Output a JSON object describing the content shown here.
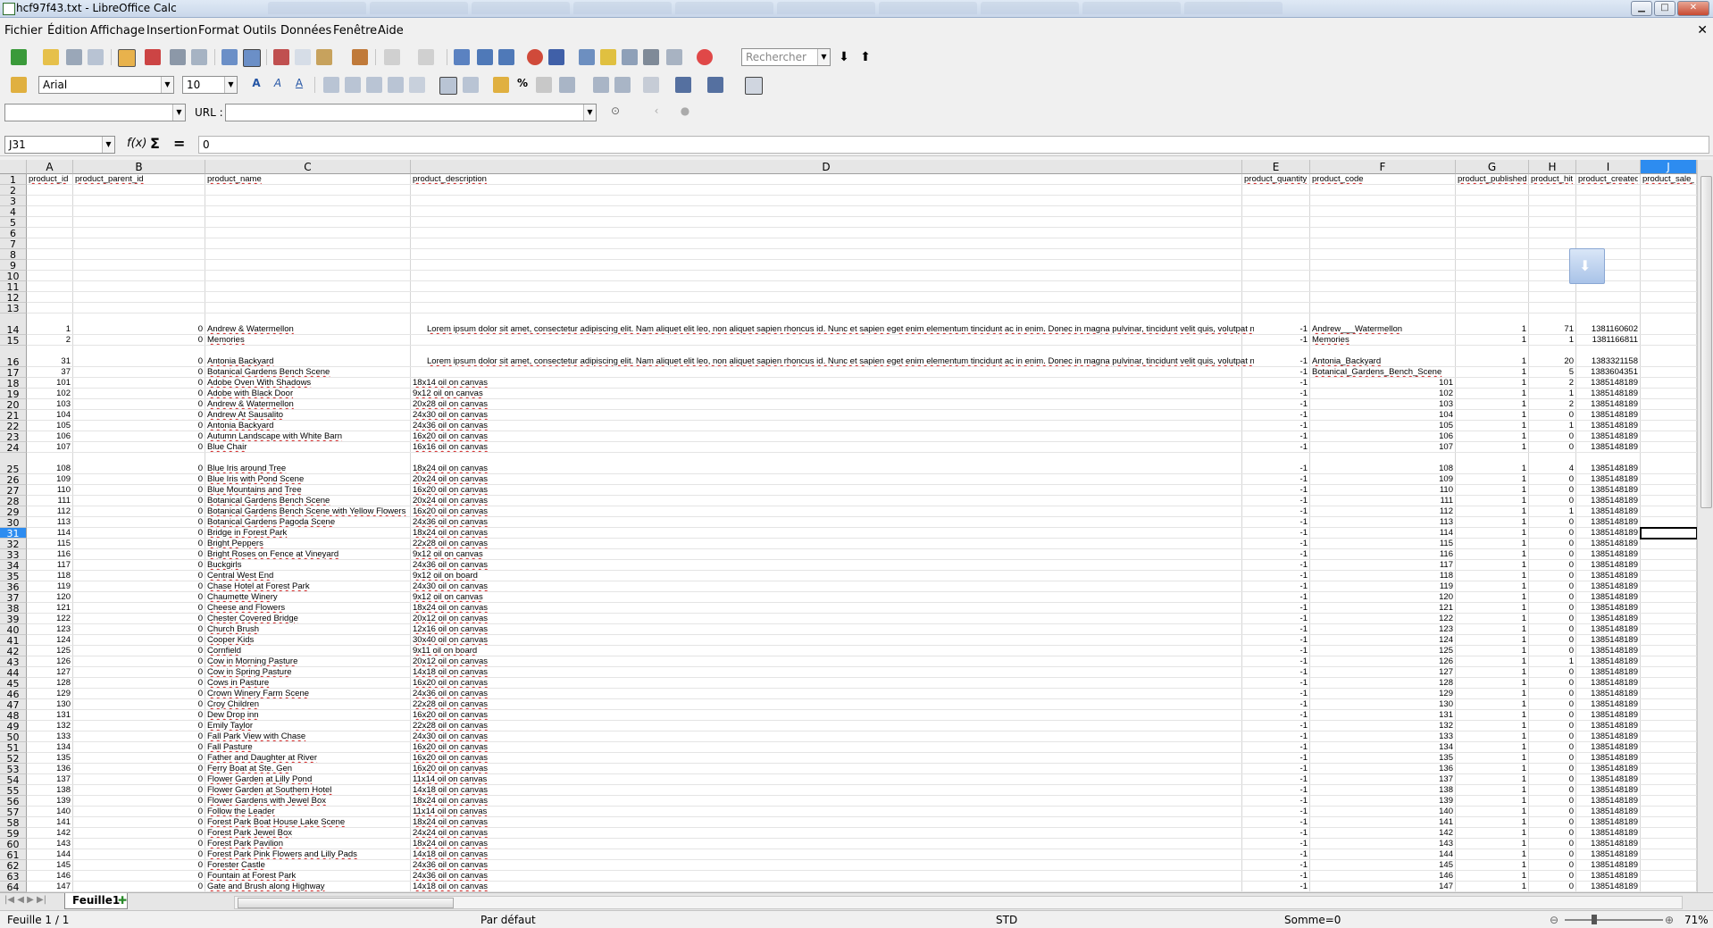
{
  "window": {
    "title": "hcf97f43.txt - LibreOffice Calc"
  },
  "menu": [
    "Fichier",
    "Édition",
    "Affichage",
    "Insertion",
    "Format",
    "Outils",
    "Données",
    "Fenêtre",
    "Aide"
  ],
  "toolbar": {
    "search_placeholder": "Rechercher",
    "font_name": "Arial",
    "font_size": "10"
  },
  "hyperlink_bar": {
    "url_label": "URL :",
    "url_value": ""
  },
  "formula_bar": {
    "name_box": "J31",
    "formula": "0"
  },
  "columns": [
    {
      "letter": "A",
      "header": "product_id"
    },
    {
      "letter": "B",
      "header": "product_parent_id"
    },
    {
      "letter": "C",
      "header": "product_name"
    },
    {
      "letter": "D",
      "header": "product_description"
    },
    {
      "letter": "E",
      "header": "product_quantity"
    },
    {
      "letter": "F",
      "header": "product_code"
    },
    {
      "letter": "G",
      "header": "product_published"
    },
    {
      "letter": "H",
      "header": "product_hit"
    },
    {
      "letter": "I",
      "header": "product_created"
    },
    {
      "letter": "J",
      "header": "product_sale_s"
    }
  ],
  "lorem": "Lorem ipsum dolor sit amet, consectetur adipiscing elit. Nam aliquet elit leo, non aliquet sapien rhoncus id. Nunc et sapien eget enim elementum tincidunt ac in enim. Donec in magna pulvinar, tincidunt velit quis, volutpat nu",
  "rows": [
    {
      "n": 14,
      "a": "1",
      "b": "0",
      "c": "Andrew & Watermellon",
      "d": "lorem",
      "e": "-1",
      "f": "Andrew___Watermellon",
      "g": "1",
      "h": "71",
      "i": "1381160602"
    },
    {
      "n": 15,
      "a": "2",
      "b": "0",
      "c": "Memories",
      "d": "",
      "e": "-1",
      "f": "Memories",
      "g": "1",
      "h": "1",
      "i": "1381166811"
    },
    {
      "n": 16,
      "a": "31",
      "b": "0",
      "c": "Antonia Backyard",
      "d": "lorem",
      "e": "-1",
      "f": "Antonia_Backyard",
      "g": "1",
      "h": "20",
      "i": "1383321158"
    },
    {
      "n": 17,
      "a": "37",
      "b": "0",
      "c": "Botanical Gardens Bench Scene",
      "d": "",
      "e": "-1",
      "f": "Botanical_Gardens_Bench_Scene",
      "g": "1",
      "h": "5",
      "i": "1383604351"
    },
    {
      "n": 18,
      "a": "101",
      "b": "0",
      "c": "Adobe Oven With Shadows",
      "d": "18x14 oil on canvas",
      "e": "-1",
      "f": "101",
      "g": "1",
      "h": "2",
      "i": "1385148189"
    },
    {
      "n": 19,
      "a": "102",
      "b": "0",
      "c": "Adobe with Black Door",
      "d": "9x12 oil on canvas",
      "e": "-1",
      "f": "102",
      "g": "1",
      "h": "1",
      "i": "1385148189"
    },
    {
      "n": 20,
      "a": "103",
      "b": "0",
      "c": "Andrew & Watermellon",
      "d": "20x28 oil on canvas",
      "e": "-1",
      "f": "103",
      "g": "1",
      "h": "2",
      "i": "1385148189"
    },
    {
      "n": 21,
      "a": "104",
      "b": "0",
      "c": "Andrew At Sausalito",
      "d": "24x30 oil on canvas",
      "e": "-1",
      "f": "104",
      "g": "1",
      "h": "0",
      "i": "1385148189"
    },
    {
      "n": 22,
      "a": "105",
      "b": "0",
      "c": "Antonia Backyard",
      "d": "24x36 oil on canvas",
      "e": "-1",
      "f": "105",
      "g": "1",
      "h": "1",
      "i": "1385148189"
    },
    {
      "n": 23,
      "a": "106",
      "b": "0",
      "c": "Autumn Landscape with White Barn",
      "d": "16x20 oil on canvas",
      "e": "-1",
      "f": "106",
      "g": "1",
      "h": "0",
      "i": "1385148189"
    },
    {
      "n": 24,
      "a": "107",
      "b": "0",
      "c": "Blue Chair",
      "d": "16x16 oil on canvas",
      "e": "-1",
      "f": "107",
      "g": "1",
      "h": "0",
      "i": "1385148189"
    },
    {
      "n": 25,
      "a": "108",
      "b": "0",
      "c": "Blue Iris around Tree",
      "d": "18x24 oil on canvas",
      "e": "-1",
      "f": "108",
      "g": "1",
      "h": "4",
      "i": "1385148189"
    },
    {
      "n": 26,
      "a": "109",
      "b": "0",
      "c": "Blue Iris with Pond Scene",
      "d": "20x24 oil on canvas",
      "e": "-1",
      "f": "109",
      "g": "1",
      "h": "0",
      "i": "1385148189"
    },
    {
      "n": 27,
      "a": "110",
      "b": "0",
      "c": "Blue Mountains and Tree",
      "d": "16x20 oil on canvas",
      "e": "-1",
      "f": "110",
      "g": "1",
      "h": "0",
      "i": "1385148189"
    },
    {
      "n": 28,
      "a": "111",
      "b": "0",
      "c": "Botanical Gardens Bench Scene",
      "d": "20x24 oil on canvas",
      "e": "-1",
      "f": "111",
      "g": "1",
      "h": "0",
      "i": "1385148189"
    },
    {
      "n": 29,
      "a": "112",
      "b": "0",
      "c": "Botanical Gardens Bench Scene with Yellow Flowers",
      "d": "16x20 oil on canvas",
      "e": "-1",
      "f": "112",
      "g": "1",
      "h": "1",
      "i": "1385148189"
    },
    {
      "n": 30,
      "a": "113",
      "b": "0",
      "c": "Botanical Gardens Pagoda Scene",
      "d": "24x36 oil on canvas",
      "e": "-1",
      "f": "113",
      "g": "1",
      "h": "0",
      "i": "1385148189"
    },
    {
      "n": 31,
      "a": "114",
      "b": "0",
      "c": "Bridge in Forest Park",
      "d": "18x24 oil on canvas",
      "e": "-1",
      "f": "114",
      "g": "1",
      "h": "0",
      "i": "1385148189"
    },
    {
      "n": 32,
      "a": "115",
      "b": "0",
      "c": "Bright Peppers",
      "d": "22x28 oil on canvas",
      "e": "-1",
      "f": "115",
      "g": "1",
      "h": "0",
      "i": "1385148189"
    },
    {
      "n": 33,
      "a": "116",
      "b": "0",
      "c": "Bright Roses on Fence at Vineyard",
      "d": "9x12 oil on canvas",
      "e": "-1",
      "f": "116",
      "g": "1",
      "h": "0",
      "i": "1385148189"
    },
    {
      "n": 34,
      "a": "117",
      "b": "0",
      "c": "Buckgirls",
      "d": "24x36 oil on canvas",
      "e": "-1",
      "f": "117",
      "g": "1",
      "h": "0",
      "i": "1385148189"
    },
    {
      "n": 35,
      "a": "118",
      "b": "0",
      "c": "Central West End",
      "d": "9x12 oil on board",
      "e": "-1",
      "f": "118",
      "g": "1",
      "h": "0",
      "i": "1385148189"
    },
    {
      "n": 36,
      "a": "119",
      "b": "0",
      "c": "Chase Hotel at Forest Park",
      "d": "24x30 oil on canvas",
      "e": "-1",
      "f": "119",
      "g": "1",
      "h": "0",
      "i": "1385148189"
    },
    {
      "n": 37,
      "a": "120",
      "b": "0",
      "c": "Chaumette Winery",
      "d": "9x12 oil on canvas",
      "e": "-1",
      "f": "120",
      "g": "1",
      "h": "0",
      "i": "1385148189"
    },
    {
      "n": 38,
      "a": "121",
      "b": "0",
      "c": "Cheese and Flowers",
      "d": "18x24 oil on canvas",
      "e": "-1",
      "f": "121",
      "g": "1",
      "h": "0",
      "i": "1385148189"
    },
    {
      "n": 39,
      "a": "122",
      "b": "0",
      "c": "Chester Covered Bridge",
      "d": "20x12 oil on canvas",
      "e": "-1",
      "f": "122",
      "g": "1",
      "h": "0",
      "i": "1385148189"
    },
    {
      "n": 40,
      "a": "123",
      "b": "0",
      "c": "Church Brush",
      "d": "12x16 oil on canvas",
      "e": "-1",
      "f": "123",
      "g": "1",
      "h": "0",
      "i": "1385148189"
    },
    {
      "n": 41,
      "a": "124",
      "b": "0",
      "c": "Cooper Kids",
      "d": "30x40 oil on canvas",
      "e": "-1",
      "f": "124",
      "g": "1",
      "h": "0",
      "i": "1385148189"
    },
    {
      "n": 42,
      "a": "125",
      "b": "0",
      "c": "Cornfield",
      "d": "9x11 oil on board",
      "e": "-1",
      "f": "125",
      "g": "1",
      "h": "0",
      "i": "1385148189"
    },
    {
      "n": 43,
      "a": "126",
      "b": "0",
      "c": "Cow in Morning Pasture",
      "d": "20x12 oil on canvas",
      "e": "-1",
      "f": "126",
      "g": "1",
      "h": "1",
      "i": "1385148189"
    },
    {
      "n": 44,
      "a": "127",
      "b": "0",
      "c": "Cow in Spring Pasture",
      "d": "14x18 oil on canvas",
      "e": "-1",
      "f": "127",
      "g": "1",
      "h": "0",
      "i": "1385148189"
    },
    {
      "n": 45,
      "a": "128",
      "b": "0",
      "c": "Cows in Pasture",
      "d": "16x20 oil on canvas",
      "e": "-1",
      "f": "128",
      "g": "1",
      "h": "0",
      "i": "1385148189"
    },
    {
      "n": 46,
      "a": "129",
      "b": "0",
      "c": "Crown Winery Farm Scene",
      "d": "24x36 oil on canvas",
      "e": "-1",
      "f": "129",
      "g": "1",
      "h": "0",
      "i": "1385148189"
    },
    {
      "n": 47,
      "a": "130",
      "b": "0",
      "c": "Croy Children",
      "d": "22x28 oil on canvas",
      "e": "-1",
      "f": "130",
      "g": "1",
      "h": "0",
      "i": "1385148189"
    },
    {
      "n": 48,
      "a": "131",
      "b": "0",
      "c": "Dew Drop inn",
      "d": "16x20 oil on canvas",
      "e": "-1",
      "f": "131",
      "g": "1",
      "h": "0",
      "i": "1385148189"
    },
    {
      "n": 49,
      "a": "132",
      "b": "0",
      "c": "Emily Taylor",
      "d": "22x28 oil on canvas",
      "e": "-1",
      "f": "132",
      "g": "1",
      "h": "0",
      "i": "1385148189"
    },
    {
      "n": 50,
      "a": "133",
      "b": "0",
      "c": "Fall Park View with Chase",
      "d": "24x30 oil on canvas",
      "e": "-1",
      "f": "133",
      "g": "1",
      "h": "0",
      "i": "1385148189"
    },
    {
      "n": 51,
      "a": "134",
      "b": "0",
      "c": "Fall Pasture",
      "d": "16x20 oil on canvas",
      "e": "-1",
      "f": "134",
      "g": "1",
      "h": "0",
      "i": "1385148189"
    },
    {
      "n": 52,
      "a": "135",
      "b": "0",
      "c": "Father and Daughter at River",
      "d": "16x20 oil on canvas",
      "e": "-1",
      "f": "135",
      "g": "1",
      "h": "0",
      "i": "1385148189"
    },
    {
      "n": 53,
      "a": "136",
      "b": "0",
      "c": "Ferry Boat at Ste. Gen",
      "d": "16x20 oil on canvas",
      "e": "-1",
      "f": "136",
      "g": "1",
      "h": "0",
      "i": "1385148189"
    },
    {
      "n": 54,
      "a": "137",
      "b": "0",
      "c": "Flower Garden at Lilly Pond",
      "d": "11x14 oil on canvas",
      "e": "-1",
      "f": "137",
      "g": "1",
      "h": "0",
      "i": "1385148189"
    },
    {
      "n": 55,
      "a": "138",
      "b": "0",
      "c": "Flower Garden at Southern Hotel",
      "d": "14x18 oil on canvas",
      "e": "-1",
      "f": "138",
      "g": "1",
      "h": "0",
      "i": "1385148189"
    },
    {
      "n": 56,
      "a": "139",
      "b": "0",
      "c": "Flower Gardens with Jewel Box",
      "d": "18x24 oil on canvas",
      "e": "-1",
      "f": "139",
      "g": "1",
      "h": "0",
      "i": "1385148189"
    },
    {
      "n": 57,
      "a": "140",
      "b": "0",
      "c": "Follow the Leader",
      "d": "11x14 oil on canvas",
      "e": "-1",
      "f": "140",
      "g": "1",
      "h": "0",
      "i": "1385148189"
    },
    {
      "n": 58,
      "a": "141",
      "b": "0",
      "c": "Forest Park Boat House Lake Scene",
      "d": "18x24 oil on canvas",
      "e": "-1",
      "f": "141",
      "g": "1",
      "h": "0",
      "i": "1385148189"
    },
    {
      "n": 59,
      "a": "142",
      "b": "0",
      "c": "Forest Park Jewel Box",
      "d": "24x24 oil on canvas",
      "e": "-1",
      "f": "142",
      "g": "1",
      "h": "0",
      "i": "1385148189"
    },
    {
      "n": 60,
      "a": "143",
      "b": "0",
      "c": "Forest Park Pavilion",
      "d": "18x24 oil on canvas",
      "e": "-1",
      "f": "143",
      "g": "1",
      "h": "0",
      "i": "1385148189"
    },
    {
      "n": 61,
      "a": "144",
      "b": "0",
      "c": "Forest Park Pink Flowers and Lilly Pads",
      "d": "14x18 oil on canvas",
      "e": "-1",
      "f": "144",
      "g": "1",
      "h": "0",
      "i": "1385148189"
    },
    {
      "n": 62,
      "a": "145",
      "b": "0",
      "c": "Forester Castle",
      "d": "24x36 oil on canvas",
      "e": "-1",
      "f": "145",
      "g": "1",
      "h": "0",
      "i": "1385148189"
    },
    {
      "n": 63,
      "a": "146",
      "b": "0",
      "c": "Fountain at Forest Park",
      "d": "24x36 oil on canvas",
      "e": "-1",
      "f": "146",
      "g": "1",
      "h": "0",
      "i": "1385148189"
    },
    {
      "n": 64,
      "a": "147",
      "b": "0",
      "c": "Gate and Brush along Highway",
      "d": "14x18 oil on canvas",
      "e": "-1",
      "f": "147",
      "g": "1",
      "h": "0",
      "i": "1385148189"
    }
  ],
  "sheet_tabs": [
    "Feuille1"
  ],
  "status": {
    "sheet": "Feuille 1 / 1",
    "style": "Par défaut",
    "mode": "STD",
    "sum": "Somme=0",
    "zoom": "71%"
  }
}
